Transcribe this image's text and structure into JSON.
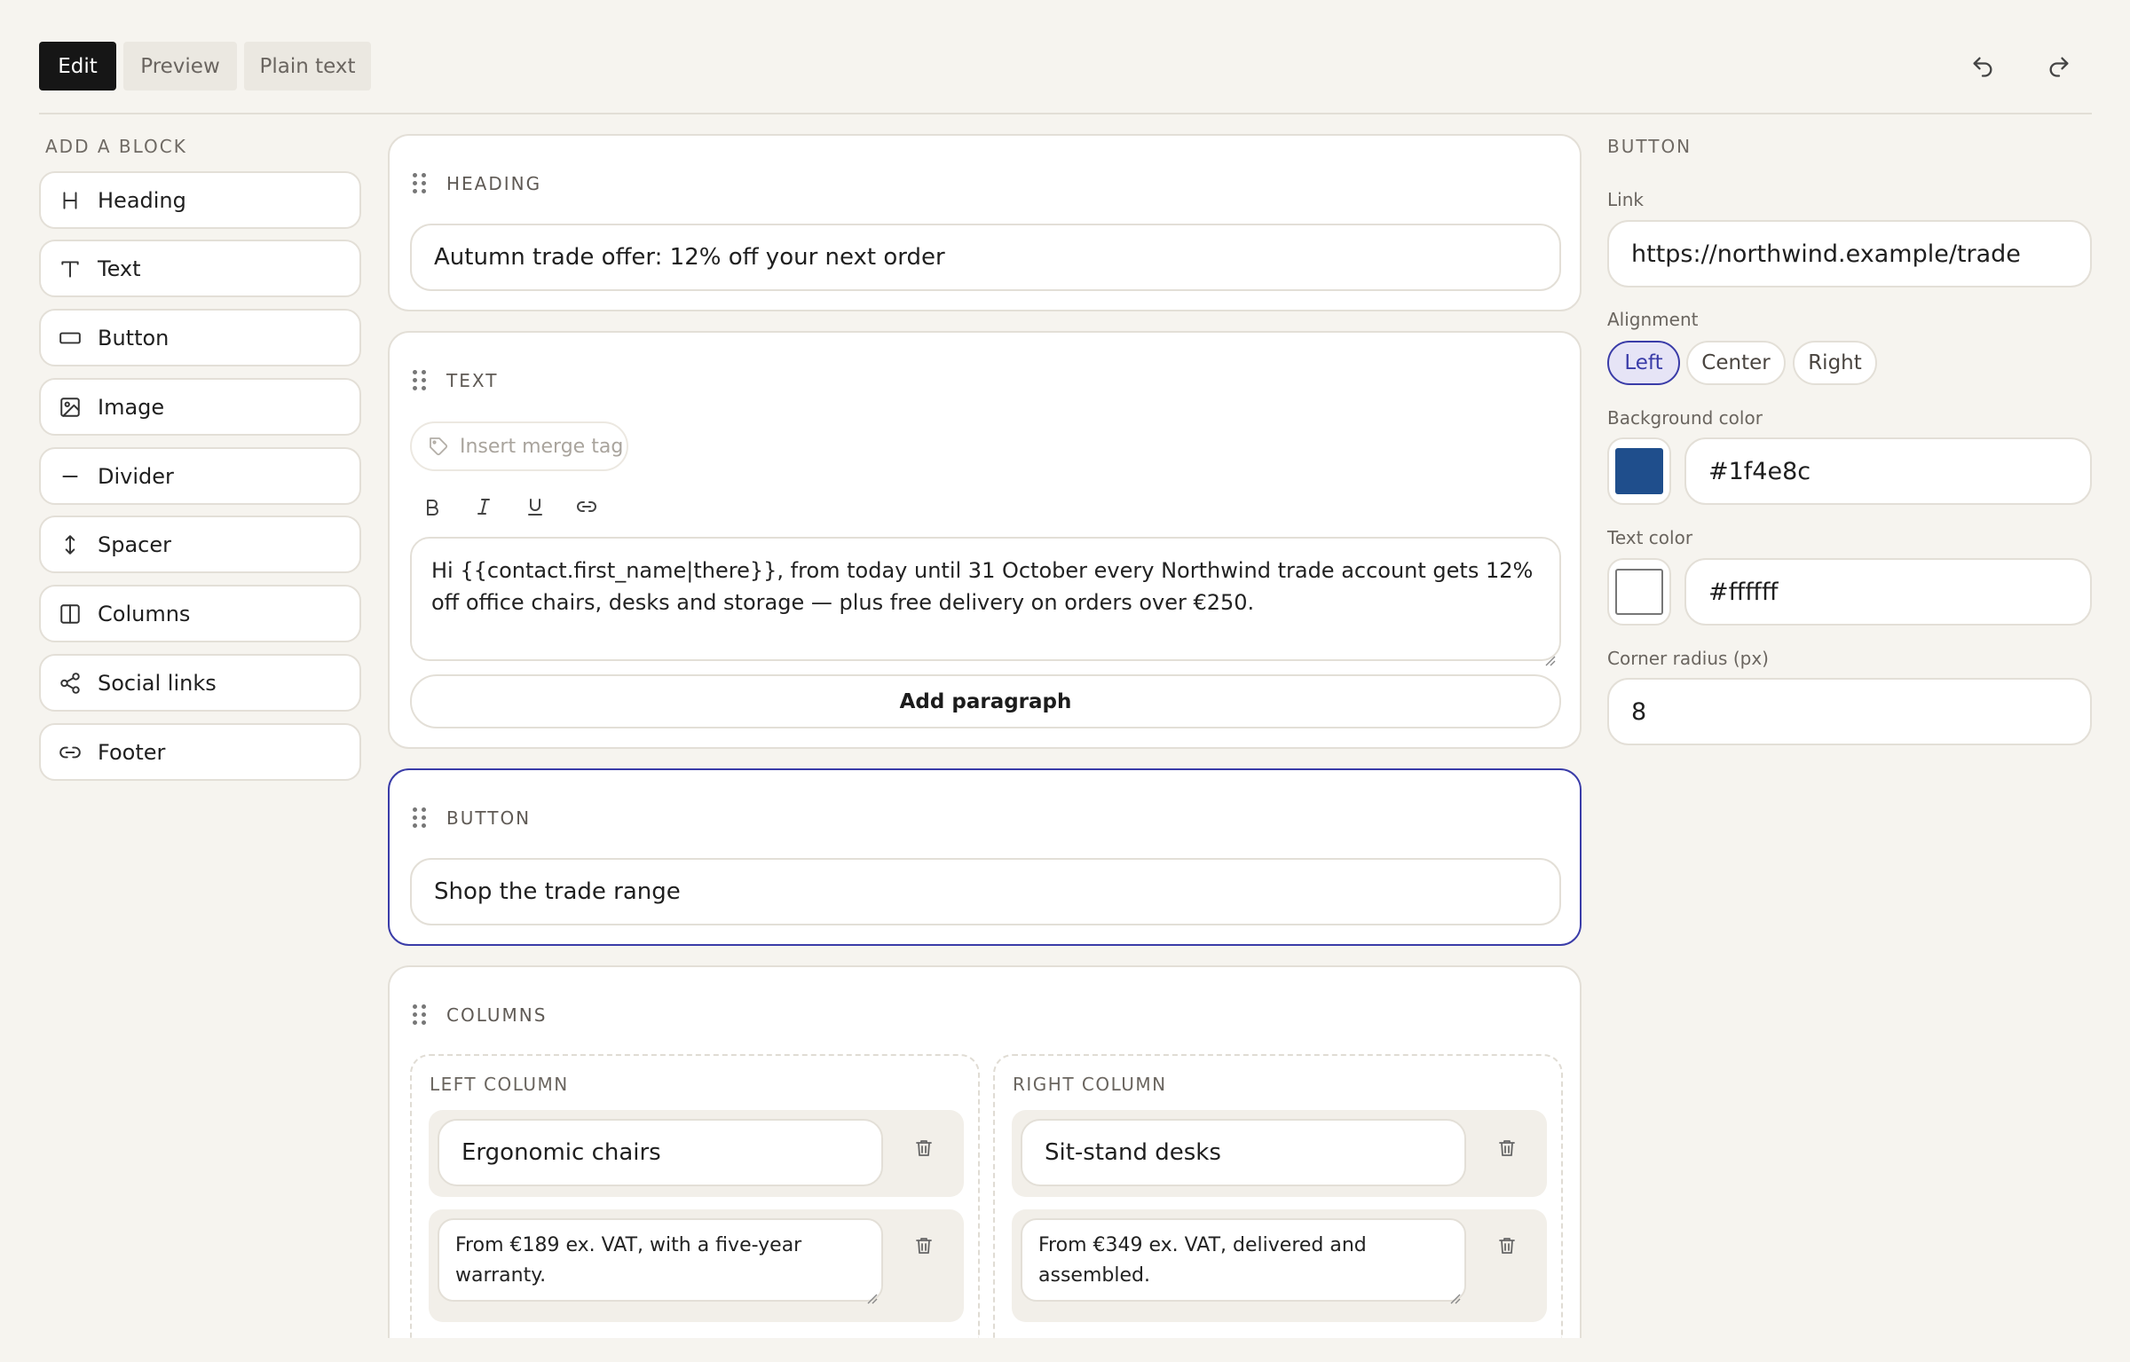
{
  "toolbar": {
    "tabs": [
      {
        "label": "Edit",
        "active": true
      },
      {
        "label": "Preview",
        "active": false
      },
      {
        "label": "Plain text",
        "active": false
      }
    ],
    "undo_icon": "undo-icon",
    "redo_icon": "redo-icon"
  },
  "palette": {
    "title": "ADD A BLOCK",
    "items": [
      {
        "label": "Heading",
        "icon": "heading-icon"
      },
      {
        "label": "Text",
        "icon": "text-icon"
      },
      {
        "label": "Button",
        "icon": "button-icon"
      },
      {
        "label": "Image",
        "icon": "image-icon"
      },
      {
        "label": "Divider",
        "icon": "divider-icon"
      },
      {
        "label": "Spacer",
        "icon": "spacer-icon"
      },
      {
        "label": "Columns",
        "icon": "columns-icon"
      },
      {
        "label": "Social links",
        "icon": "share-icon"
      },
      {
        "label": "Footer",
        "icon": "link-icon"
      }
    ]
  },
  "blocks": {
    "heading": {
      "title": "HEADING",
      "value": "Autumn trade offer: 12% off your next order"
    },
    "text": {
      "title": "TEXT",
      "merge_tag_label": "Insert merge tag",
      "format_icons": [
        "bold-icon",
        "italic-icon",
        "underline-icon",
        "link-icon"
      ],
      "body": "Hi {{contact.first_name|there}}, from today until 31 October every Northwind trade account gets 12% off office chairs, desks and storage — plus free delivery on orders over €250.",
      "add_paragraph_label": "Add paragraph"
    },
    "button": {
      "title": "BUTTON",
      "value": "Shop the trade range",
      "selected": true
    },
    "columns": {
      "title": "COLUMNS",
      "left": {
        "title": "LEFT COLUMN",
        "heading": "Ergonomic chairs",
        "body": "From €189 ex. VAT, with a five-year warranty."
      },
      "right": {
        "title": "RIGHT COLUMN",
        "heading": "Sit-stand desks",
        "body": "From €349 ex. VAT, delivered and assembled."
      }
    }
  },
  "inspector": {
    "title": "BUTTON",
    "link_label": "Link",
    "link_value": "https://northwind.example/trade",
    "alignment_label": "Alignment",
    "alignment_options": [
      "Left",
      "Center",
      "Right"
    ],
    "alignment_selected": "Left",
    "bg_label": "Background color",
    "bg_value": "#1f4e8c",
    "text_color_label": "Text color",
    "text_color_value": "#ffffff",
    "radius_label": "Corner radius (px)",
    "radius_value": "8"
  },
  "colors": {
    "accent": "#3a3ca8",
    "dark": "#161616"
  }
}
